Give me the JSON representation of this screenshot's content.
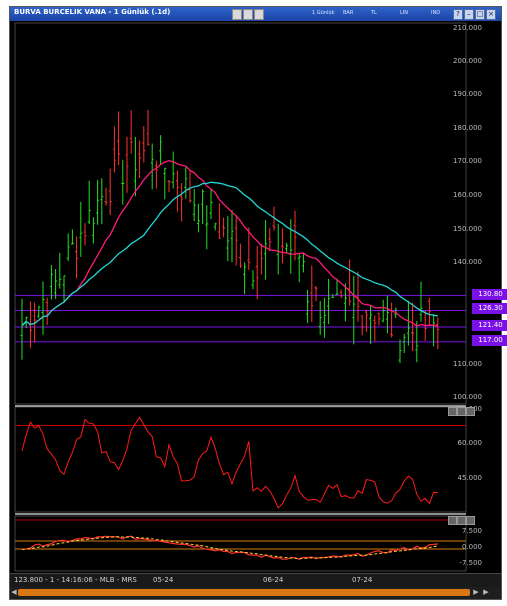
{
  "window": {
    "title": "BURVA BURCELIK VANA - 1 Günlük (.1d)"
  },
  "toolbar": {
    "items": [
      "1 Günlük",
      "BAR",
      "TL",
      "LIN",
      "IND"
    ]
  },
  "price_axis": {
    "ticks": [
      "210.000",
      "200.000",
      "190.000",
      "180.000",
      "170.000",
      "160.000",
      "150.000",
      "140.000",
      "110.000",
      "100.000"
    ],
    "levels": [
      "130.80",
      "126.30",
      "121.40",
      "117.00"
    ],
    "level_color": "#7a12e8"
  },
  "rsi_axis": {
    "ticks": [
      "75.000",
      "60.000",
      "45.000"
    ]
  },
  "osc_axis": {
    "ticks": [
      "7.500",
      "0.000",
      "-7.500"
    ]
  },
  "status": {
    "text": "123.800 - 1 - 14:16:06 - MLB - MRS"
  },
  "date_axis": {
    "labels": [
      "05-24",
      "06-24",
      "07-24"
    ]
  },
  "colors": {
    "ma_fast": "#ff1a7a",
    "ma_slow": "#22d6d6",
    "bar_up": "#23e023",
    "bar_down": "#ff3030",
    "rsi": "#ff1a1a",
    "osc_signal": "#ffcc33"
  }
}
